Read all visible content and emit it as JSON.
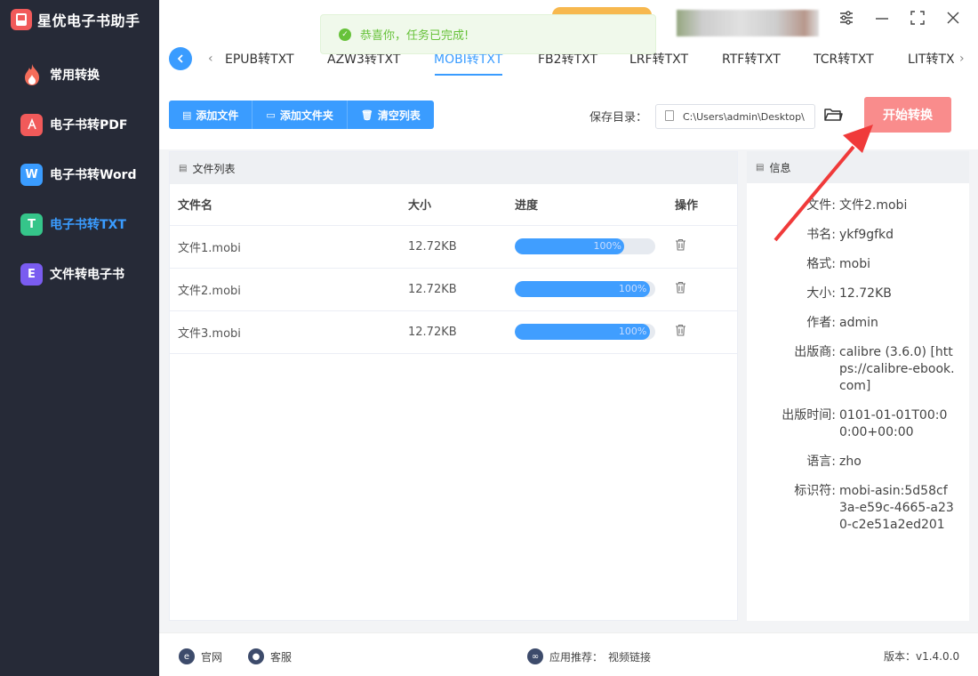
{
  "app": {
    "title": "星优电子书助手"
  },
  "sidebar": {
    "items": [
      {
        "label": "常用转换",
        "icon": "fire-icon",
        "glyph": "🔥",
        "color": "#f46d5a"
      },
      {
        "label": "电子书转PDF",
        "icon": "pdf-icon",
        "glyph": "⅄",
        "color": "#f15a5a"
      },
      {
        "label": "电子书转Word",
        "icon": "word-icon",
        "glyph": "W",
        "color": "#3a9cff"
      },
      {
        "label": "电子书转TXT",
        "icon": "txt-icon",
        "glyph": "T",
        "color": "#35c58a"
      },
      {
        "label": "文件转电子书",
        "icon": "ebook-icon",
        "glyph": "E",
        "color": "#7a5cf0"
      }
    ],
    "active_index": 3
  },
  "toast": {
    "message": "恭喜你，任务已完成!",
    "type": "success"
  },
  "tabs": [
    "EPUB转TXT",
    "AZW3转TXT",
    "MOBI转TXT",
    "FB2转TXT",
    "LRF转TXT",
    "RTF转TXT",
    "TCR转TXT",
    "LIT转TX"
  ],
  "active_tab": "MOBI转TXT",
  "toolbar": {
    "add_file": "添加文件",
    "add_folder": "添加文件夹",
    "clear_list": "清空列表",
    "save_dir_label": "保存目录：",
    "save_dir_value": "C:\\Users\\admin\\Desktop\\",
    "start_label": "开始转换"
  },
  "file_list": {
    "title": "文件列表",
    "columns": [
      "文件名",
      "大小",
      "进度",
      "操作"
    ],
    "rows": [
      {
        "name": "文件1.mobi",
        "size": "12.72KB",
        "progress": 0.78,
        "progress_label": "100%"
      },
      {
        "name": "文件2.mobi",
        "size": "12.72KB",
        "progress": 0.96,
        "progress_label": "100%"
      },
      {
        "name": "文件3.mobi",
        "size": "12.72KB",
        "progress": 0.96,
        "progress_label": "100%"
      }
    ]
  },
  "info": {
    "title": "信息",
    "fields": [
      {
        "key": "文件:",
        "value": "文件2.mobi"
      },
      {
        "key": "书名:",
        "value": "ykf9gfkd"
      },
      {
        "key": "格式:",
        "value": "mobi"
      },
      {
        "key": "大小:",
        "value": "12.72KB"
      },
      {
        "key": "作者:",
        "value": "admin"
      },
      {
        "key": "出版商:",
        "value": "calibre (3.6.0) [https://calibre-ebook.com]"
      },
      {
        "key": "出版时间:",
        "value": "0101-01-01T00:00:00+00:00"
      },
      {
        "key": "语言:",
        "value": "zho"
      },
      {
        "key": "标识符:",
        "value": "mobi-asin:5d58cf3a-e59c-4665-a230-c2e51a2ed201"
      }
    ]
  },
  "footer": {
    "website": "官网",
    "support": "客服",
    "recommend_label": "应用推荐：",
    "recommend_value": "视频链接",
    "version": "版本：v1.4.0.0"
  },
  "colors": {
    "accent": "#3a9cff",
    "sidebar_bg": "#262a37",
    "start_button": "#f98c8c",
    "success": "#67c23a",
    "annotation_arrow": "#f03a3a"
  }
}
